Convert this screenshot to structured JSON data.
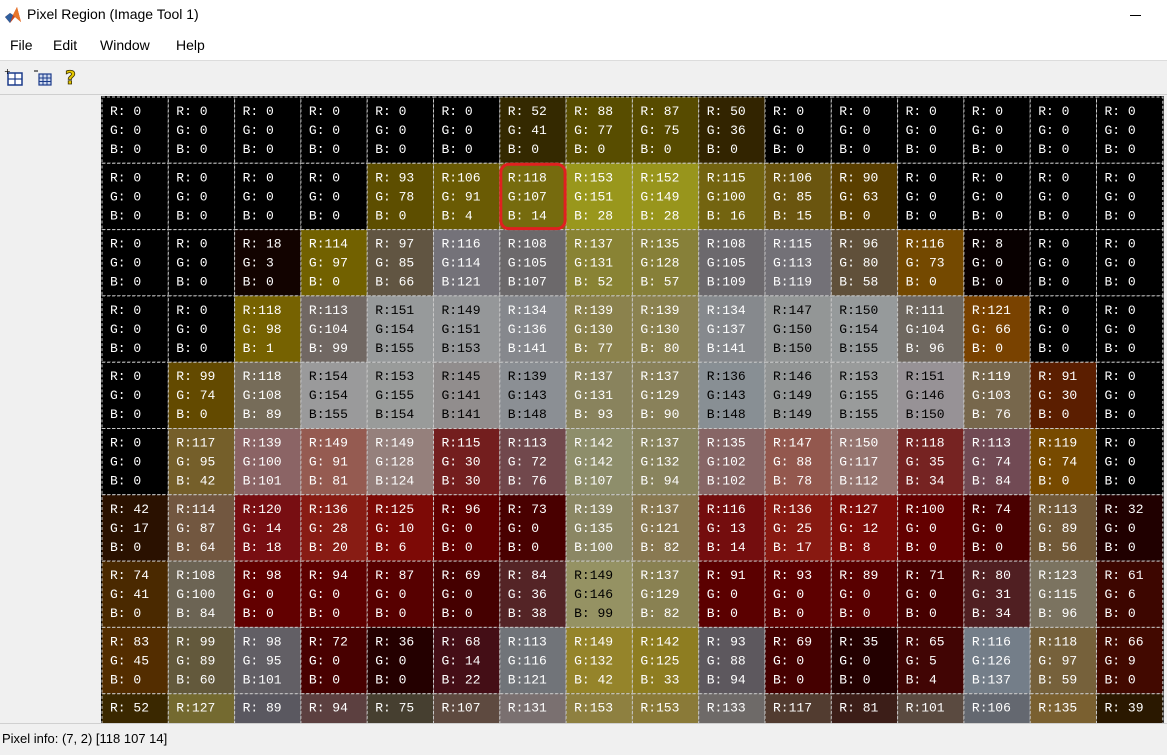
{
  "window": {
    "title": "Pixel Region (Image Tool 1)",
    "icon": "matlab-icon"
  },
  "menu": {
    "items": [
      "File",
      "Edit",
      "Window",
      "Help"
    ]
  },
  "toolbar": {
    "buttons": [
      "new-figure-icon",
      "copy-table-icon",
      "help-icon"
    ]
  },
  "pixel_grid": {
    "selected": {
      "row": 1,
      "col": 6
    },
    "highlight_color": "#e02020",
    "rows": [
      [
        [
          0,
          0,
          0
        ],
        [
          0,
          0,
          0
        ],
        [
          0,
          0,
          0
        ],
        [
          0,
          0,
          0
        ],
        [
          0,
          0,
          0
        ],
        [
          0,
          0,
          0
        ],
        [
          52,
          41,
          0
        ],
        [
          88,
          77,
          0
        ],
        [
          87,
          75,
          0
        ],
        [
          50,
          36,
          0
        ],
        [
          0,
          0,
          0
        ],
        [
          0,
          0,
          0
        ],
        [
          0,
          0,
          0
        ],
        [
          0,
          0,
          0
        ],
        [
          0,
          0,
          0
        ],
        [
          0,
          0,
          0
        ]
      ],
      [
        [
          0,
          0,
          0
        ],
        [
          0,
          0,
          0
        ],
        [
          0,
          0,
          0
        ],
        [
          0,
          0,
          0
        ],
        [
          93,
          78,
          0
        ],
        [
          106,
          91,
          4
        ],
        [
          118,
          107,
          14
        ],
        [
          153,
          151,
          28
        ],
        [
          152,
          149,
          28
        ],
        [
          115,
          100,
          16
        ],
        [
          106,
          85,
          15
        ],
        [
          90,
          63,
          0
        ],
        [
          0,
          0,
          0
        ],
        [
          0,
          0,
          0
        ],
        [
          0,
          0,
          0
        ],
        [
          0,
          0,
          0
        ]
      ],
      [
        [
          0,
          0,
          0
        ],
        [
          0,
          0,
          0
        ],
        [
          18,
          3,
          0
        ],
        [
          114,
          97,
          0
        ],
        [
          97,
          85,
          66
        ],
        [
          116,
          114,
          121
        ],
        [
          108,
          105,
          107
        ],
        [
          137,
          131,
          52
        ],
        [
          135,
          128,
          57
        ],
        [
          108,
          105,
          109
        ],
        [
          115,
          113,
          119
        ],
        [
          96,
          80,
          58
        ],
        [
          116,
          73,
          0
        ],
        [
          8,
          0,
          0
        ],
        [
          0,
          0,
          0
        ],
        [
          0,
          0,
          0
        ]
      ],
      [
        [
          0,
          0,
          0
        ],
        [
          0,
          0,
          0
        ],
        [
          118,
          98,
          1
        ],
        [
          113,
          104,
          99
        ],
        [
          151,
          154,
          155
        ],
        [
          149,
          151,
          153
        ],
        [
          134,
          136,
          141
        ],
        [
          139,
          130,
          77
        ],
        [
          139,
          130,
          80
        ],
        [
          134,
          137,
          141
        ],
        [
          147,
          150,
          150
        ],
        [
          150,
          154,
          155
        ],
        [
          111,
          104,
          96
        ],
        [
          121,
          66,
          0
        ],
        [
          0,
          0,
          0
        ],
        [
          0,
          0,
          0
        ]
      ],
      [
        [
          0,
          0,
          0
        ],
        [
          99,
          74,
          0
        ],
        [
          118,
          108,
          89
        ],
        [
          154,
          154,
          155
        ],
        [
          153,
          155,
          154
        ],
        [
          145,
          141,
          141
        ],
        [
          139,
          143,
          148
        ],
        [
          137,
          131,
          93
        ],
        [
          137,
          129,
          90
        ],
        [
          136,
          143,
          148
        ],
        [
          146,
          149,
          149
        ],
        [
          153,
          155,
          155
        ],
        [
          151,
          146,
          150
        ],
        [
          119,
          103,
          76
        ],
        [
          91,
          30,
          0
        ],
        [
          0,
          0,
          0
        ]
      ],
      [
        [
          0,
          0,
          0
        ],
        [
          117,
          95,
          42
        ],
        [
          139,
          100,
          101
        ],
        [
          149,
          91,
          81
        ],
        [
          149,
          128,
          124
        ],
        [
          115,
          30,
          30
        ],
        [
          113,
          72,
          76
        ],
        [
          142,
          142,
          107
        ],
        [
          137,
          132,
          94
        ],
        [
          135,
          102,
          102
        ],
        [
          147,
          88,
          78
        ],
        [
          150,
          117,
          112
        ],
        [
          118,
          35,
          34
        ],
        [
          113,
          74,
          84
        ],
        [
          119,
          74,
          0
        ],
        [
          0,
          0,
          0
        ]
      ],
      [
        [
          42,
          17,
          0
        ],
        [
          114,
          87,
          64
        ],
        [
          120,
          14,
          18
        ],
        [
          136,
          28,
          20
        ],
        [
          125,
          10,
          6
        ],
        [
          96,
          0,
          0
        ],
        [
          73,
          0,
          0
        ],
        [
          139,
          135,
          100
        ],
        [
          137,
          121,
          82
        ],
        [
          116,
          13,
          14
        ],
        [
          136,
          25,
          17
        ],
        [
          127,
          12,
          8
        ],
        [
          100,
          0,
          0
        ],
        [
          74,
          0,
          0
        ],
        [
          113,
          89,
          56
        ],
        [
          32,
          0,
          0
        ]
      ],
      [
        [
          74,
          41,
          0
        ],
        [
          108,
          100,
          84
        ],
        [
          98,
          0,
          0
        ],
        [
          94,
          0,
          0
        ],
        [
          87,
          0,
          0
        ],
        [
          69,
          0,
          0
        ],
        [
          84,
          36,
          38
        ],
        [
          149,
          146,
          99
        ],
        [
          137,
          129,
          82
        ],
        [
          91,
          0,
          0
        ],
        [
          93,
          0,
          0
        ],
        [
          89,
          0,
          0
        ],
        [
          71,
          0,
          0
        ],
        [
          80,
          31,
          34
        ],
        [
          123,
          115,
          96
        ],
        [
          61,
          6,
          0
        ]
      ],
      [
        [
          83,
          45,
          0
        ],
        [
          99,
          89,
          60
        ],
        [
          98,
          95,
          101
        ],
        [
          72,
          0,
          0
        ],
        [
          36,
          0,
          0
        ],
        [
          68,
          14,
          22
        ],
        [
          113,
          116,
          121
        ],
        [
          149,
          132,
          42
        ],
        [
          142,
          125,
          33
        ],
        [
          93,
          88,
          94
        ],
        [
          69,
          0,
          0
        ],
        [
          35,
          0,
          0
        ],
        [
          65,
          5,
          4
        ],
        [
          116,
          126,
          137
        ],
        [
          118,
          97,
          59
        ],
        [
          66,
          9,
          0
        ]
      ],
      [
        [
          52,
          null,
          null
        ],
        [
          127,
          null,
          null
        ],
        [
          89,
          null,
          null
        ],
        [
          94,
          null,
          null
        ],
        [
          75,
          null,
          null
        ],
        [
          107,
          null,
          null
        ],
        [
          131,
          null,
          null
        ],
        [
          153,
          null,
          null
        ],
        [
          153,
          null,
          null
        ],
        [
          133,
          null,
          null
        ],
        [
          117,
          null,
          null
        ],
        [
          81,
          null,
          null
        ],
        [
          101,
          null,
          null
        ],
        [
          106,
          null,
          null
        ],
        [
          135,
          null,
          null
        ],
        [
          39,
          null,
          null
        ]
      ]
    ],
    "edge_row_tints": [
      "#3a2800",
      "#746a30",
      "#5a5860",
      "#5c4040",
      "#463f30",
      "#5e4a40",
      "#7a7070",
      "#8e8040",
      "#8a7a38",
      "#6e6a68",
      "#523c30",
      "#3c1e18",
      "#5a4a40",
      "#646870",
      "#7a6030",
      "#2a1800"
    ]
  },
  "status": {
    "text": "Pixel info: (7, 2)  [118 107 14]"
  }
}
